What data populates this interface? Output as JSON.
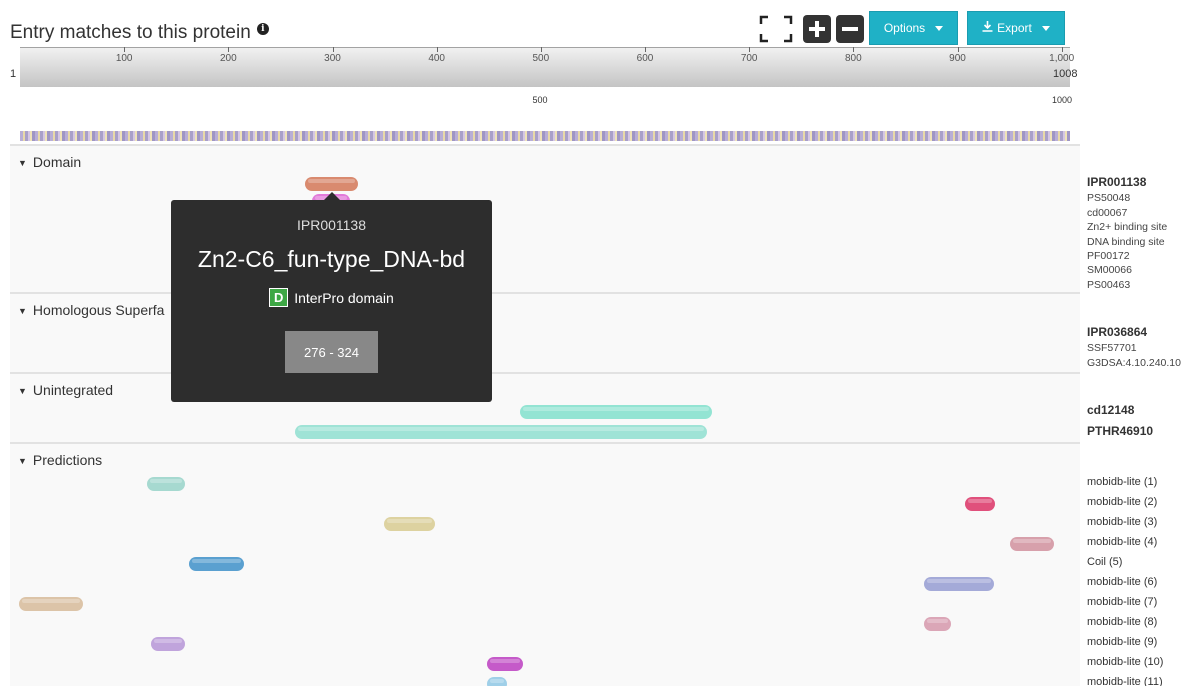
{
  "header": {
    "title": "Entry matches to this protein",
    "info_icon": "i",
    "options_label": "Options",
    "export_label": "Export",
    "export_icon": "download-icon"
  },
  "ruler": {
    "start": "1",
    "end": "1008",
    "ticks": [
      "100",
      "200",
      "300",
      "400",
      "500",
      "600",
      "700",
      "800",
      "900",
      "1,000"
    ],
    "secondary_ticks": [
      "500",
      "1000"
    ]
  },
  "sections": {
    "domain": "Domain",
    "homologous": "Homologous Superfa",
    "unintegrated": "Unintegrated",
    "predictions": "Predictions"
  },
  "labels": {
    "domain": {
      "entry": "IPR001138",
      "members": [
        "PS50048",
        "cd00067",
        "Zn2+ binding site",
        "DNA binding site",
        "PF00172",
        "SM00066",
        "PS00463"
      ]
    },
    "homologous": {
      "entry": "IPR036864",
      "members": [
        "SSF57701",
        "G3DSA:4.10.240.10"
      ]
    },
    "unintegrated": [
      "cd12148",
      "PTHR46910"
    ],
    "predictions": [
      "mobidb-lite (1)",
      "mobidb-lite (2)",
      "mobidb-lite (3)",
      "mobidb-lite (4)",
      "Coil (5)",
      "mobidb-lite (6)",
      "mobidb-lite (7)",
      "mobidb-lite (8)",
      "mobidb-lite (9)",
      "mobidb-lite (10)",
      "mobidb-lite (11)"
    ]
  },
  "tooltip": {
    "accession": "IPR001138",
    "name": "Zn2-C6_fun-type_DNA-bd",
    "badge": "D",
    "type": "InterPro domain",
    "range": "276 - 324"
  },
  "colors": {
    "accent": "#1fb1c6",
    "domain_bar": "#d98a6f",
    "domain_bar2": "#e27ad9",
    "unintegrated_bar": "#8fe3d1",
    "tooltip_bg": "#2d2d2d"
  }
}
